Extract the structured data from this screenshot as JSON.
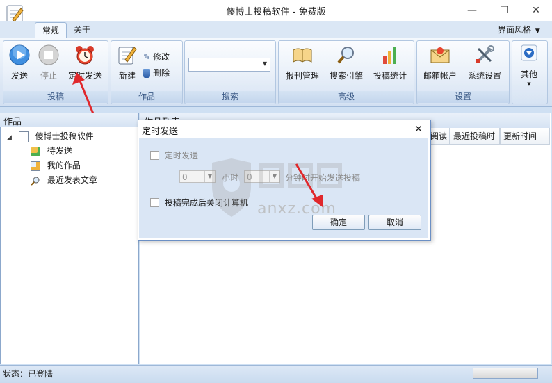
{
  "window": {
    "title": "傻博士投稿软件 - 免费版",
    "minimize_icon": "—",
    "maximize_icon": "☐",
    "close_icon": "✕"
  },
  "tabs": [
    {
      "label": "常规",
      "active": true
    },
    {
      "label": "关于",
      "active": false
    }
  ],
  "theme_menu": "界面风格",
  "ribbon": {
    "groups": {
      "submit": "投稿",
      "works": "作品",
      "search": "搜索",
      "advanced": "高级",
      "settings": "设置"
    },
    "buttons": {
      "send": "发送",
      "stop": "停止",
      "timed_send": "定时发送",
      "new": "新建",
      "edit": "修改",
      "delete": "删除",
      "journal_manage": "报刊管理",
      "search_engine": "搜索引擎",
      "submit_stats": "投稿统计",
      "mail_account": "邮箱帐户",
      "system_settings": "系统设置",
      "other": "其他"
    }
  },
  "left_pane": {
    "title": "作品",
    "root": "傻博士投稿软件",
    "items": [
      "待发送",
      "我的作品",
      "最近发表文章"
    ]
  },
  "right_pane": {
    "title": "作品列表",
    "columns": [
      "阅读",
      "最近投稿时",
      "更新时间"
    ]
  },
  "status": "状态：已登陆",
  "dialog": {
    "title": "定时发送",
    "close_icon": "✕",
    "timed_checkbox_label": "定时发送",
    "hours_value": "0",
    "hours_unit": "小时",
    "minutes_value": "0",
    "minutes_suffix": "分钟时开始发送投稿",
    "shutdown_checkbox_label": "投稿完成后关闭计算机",
    "ok_label": "确定",
    "cancel_label": "取消"
  },
  "watermark": "anxz.com",
  "colors": {
    "accent": "#2b6cc4",
    "arrow": "#e0282c",
    "ribbon_bg": "#dbe6f4"
  }
}
